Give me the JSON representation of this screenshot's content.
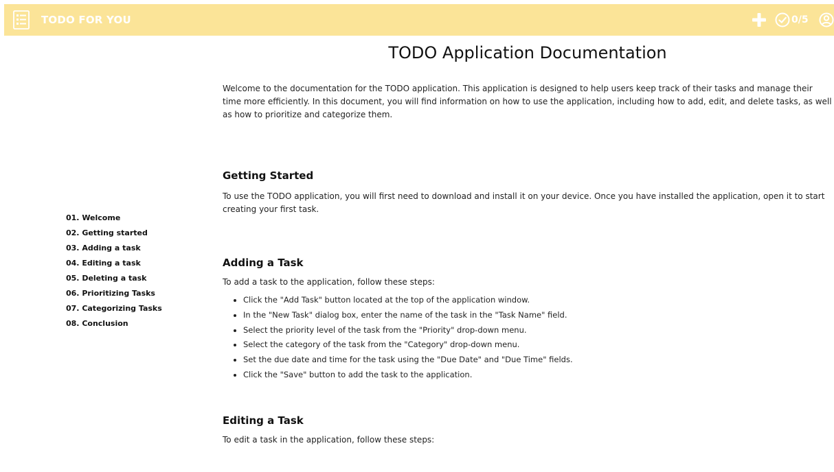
{
  "app": {
    "title": "TODO FOR YOU",
    "progress": "0/5",
    "colors": {
      "header_bg": "#fbe498",
      "header_fg": "#ffffff"
    },
    "icons": {
      "logo": "list-icon",
      "add": "plus-icon",
      "progress": "check-circle-icon",
      "user": "user-circle-icon"
    }
  },
  "doc": {
    "title": "TODO Application Documentation",
    "intro": "Welcome to the documentation for the TODO application. This application is designed to help users keep track of their tasks and manage their time more efficiently. In this document, you will find information on how to use the application, including how to add, edit, and delete tasks, as well as how to prioritize and categorize them."
  },
  "toc": {
    "items": [
      "01. Welcome",
      "02. Getting started",
      "03. Adding a task",
      "04. Editing a task",
      "05. Deleting a task",
      "06. Prioritizing Tasks",
      "07. Categorizing Tasks",
      "08. Conclusion"
    ]
  },
  "sections": {
    "getting_started": {
      "heading": "Getting Started",
      "text": "To use the TODO application, you will first need to download and install it on your device. Once you have installed the application, open it to start creating your first task."
    },
    "adding": {
      "heading": "Adding a Task",
      "intro": "To add a task to the application, follow these steps:",
      "steps": [
        "Click the \"Add Task\" button located at the top of the application window.",
        "In the \"New Task\" dialog box, enter the name of the task in the \"Task Name\" field.",
        "Select the priority level of the task from the \"Priority\" drop-down menu.",
        "Select the category of the task from the \"Category\" drop-down menu.",
        "Set the due date and time for the task using the \"Due Date\" and \"Due Time\" fields.",
        "Click the \"Save\" button to add the task to the application."
      ]
    },
    "editing": {
      "heading": "Editing a Task",
      "intro": "To edit a task in the application, follow these steps:"
    }
  }
}
